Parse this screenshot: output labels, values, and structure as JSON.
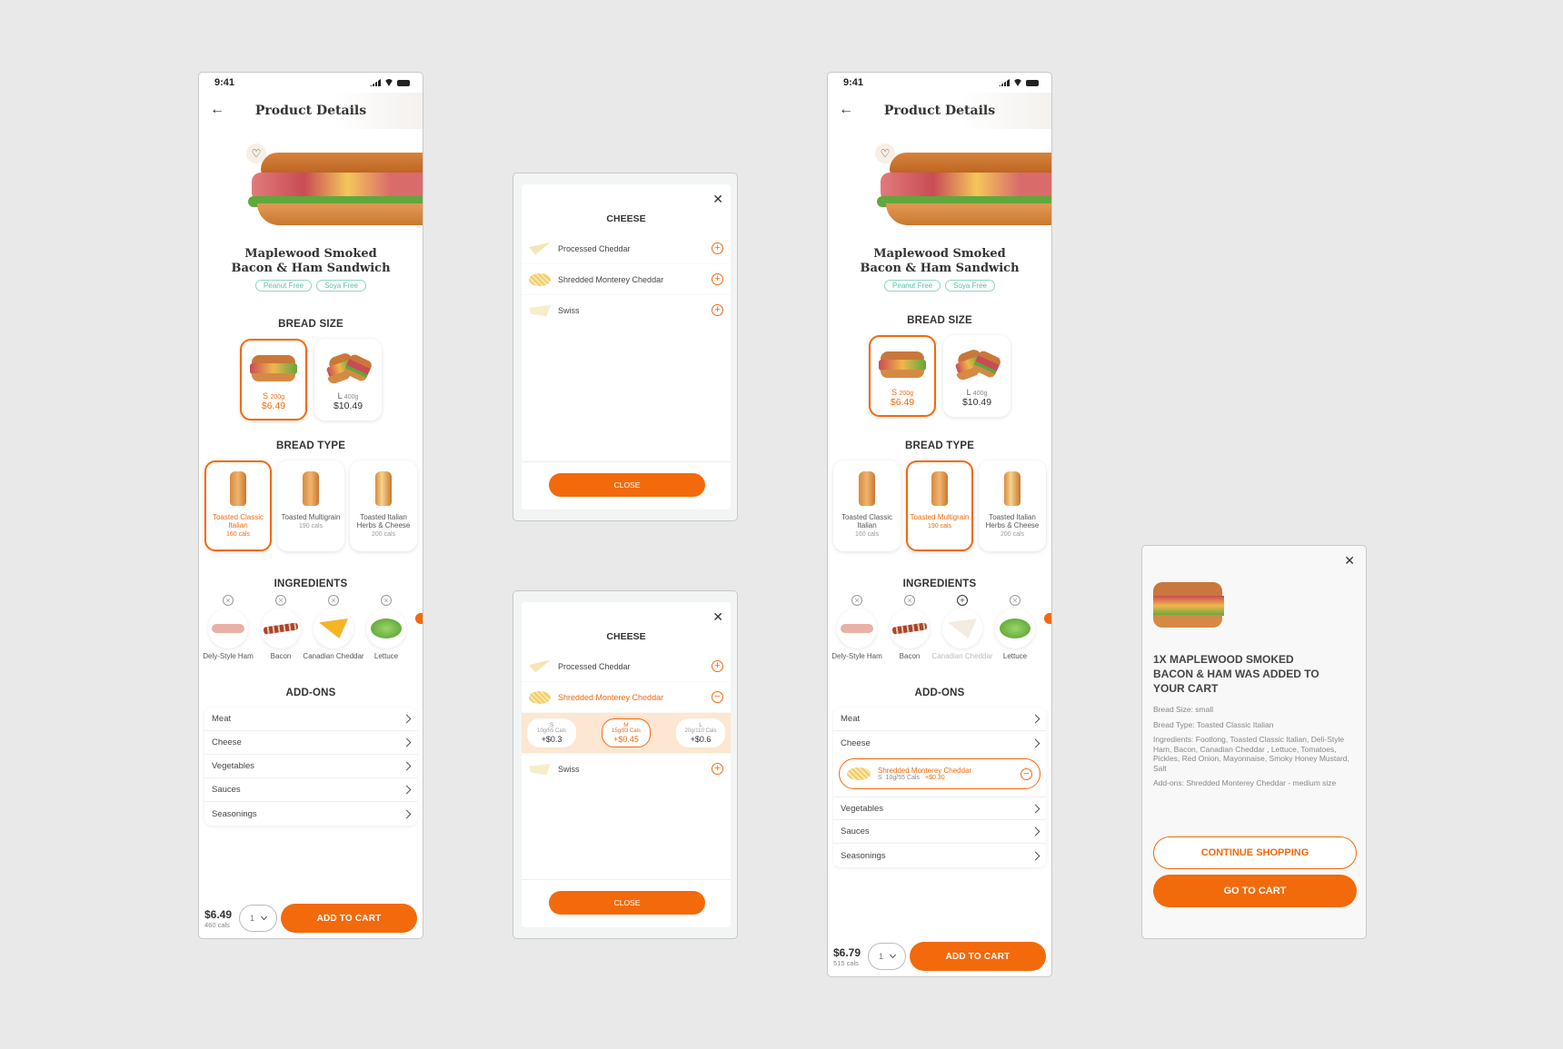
{
  "colors": {
    "accent": "#f26a0c",
    "background": "#e9e9e9",
    "tag": "#5bbfa6"
  },
  "screen1": {
    "time": "9:41",
    "title": "Product Details",
    "product_name_1": "Maplewood Smoked",
    "product_name_2": "Bacon & Ham Sandwich",
    "tags": [
      "Peanut Free",
      "Soya Free"
    ],
    "bread_size_label": "BREAD SIZE",
    "sizes": [
      {
        "size": "S",
        "weight": "200g",
        "price": "$6.49"
      },
      {
        "size": "L",
        "weight": "400g",
        "price": "$10.49"
      }
    ],
    "bread_type_label": "BREAD TYPE",
    "types": [
      {
        "name": "Toasted Classic Italian",
        "cals": "160 cals"
      },
      {
        "name": "Toasted Multigrain",
        "cals": "190 cals"
      },
      {
        "name": "Toasted Italian Herbs & Cheese",
        "cals": "200 cals"
      }
    ],
    "ingredients_label": "INGREDIENTS",
    "ingredients": [
      "Dely-Style Ham",
      "Bacon",
      "Canadian Cheddar",
      "Lettuce"
    ],
    "addons_label": "ADD-ONS",
    "addons": [
      "Meat",
      "Cheese",
      "Vegetables",
      "Sauces",
      "Seasonings"
    ],
    "price": "$6.49",
    "cals": "460 cals",
    "qty": "1",
    "add_to_cart": "ADD TO CART"
  },
  "modal1": {
    "title": "CHEESE",
    "items": [
      "Processed Cheddar",
      "Shredded Monterey Cheddar",
      "Swiss"
    ],
    "close": "CLOSE"
  },
  "modal2": {
    "title": "CHEESE",
    "items": [
      "Processed Cheddar",
      "Shredded Monterey Cheddar",
      "Swiss"
    ],
    "portions": [
      {
        "size": "S",
        "cals": "10g/55 Cals",
        "price": "+$0.3"
      },
      {
        "size": "M",
        "cals": "15g/83 Cals",
        "price": "+$0.45"
      },
      {
        "size": "L",
        "cals": "20g/110 Cals",
        "price": "+$0.6"
      }
    ],
    "close": "CLOSE"
  },
  "screen2": {
    "time": "9:41",
    "title": "Product Details",
    "product_name_1": "Maplewood Smoked",
    "product_name_2": "Bacon & Ham Sandwich",
    "tags": [
      "Peanut Free",
      "Soya Free"
    ],
    "bread_size_label": "BREAD SIZE",
    "sizes": [
      {
        "size": "S",
        "weight": "200g",
        "price": "$6.49"
      },
      {
        "size": "L",
        "weight": "400g",
        "price": "$10.49"
      }
    ],
    "bread_type_label": "BREAD TYPE",
    "types": [
      {
        "name": "Toasted Classic Italian",
        "cals": "160 cals"
      },
      {
        "name": "Toasted Multigrain",
        "cals": "190 cals"
      },
      {
        "name": "Toasted Italian Herbs & Cheese",
        "cals": "200 cals"
      }
    ],
    "ingredients_label": "INGREDIENTS",
    "ingredients": [
      "Dely-Style Ham",
      "Bacon",
      "Canadian Cheddar",
      "Lettuce"
    ],
    "addons_label": "ADD-ONS",
    "addons": [
      "Meat",
      "Cheese",
      "Vegetables",
      "Sauces",
      "Seasonings"
    ],
    "selected_addon": {
      "name": "Shredded Monterey Cheddar",
      "size": "S",
      "cals": "10g/55 Cals",
      "price": "+$0.30"
    },
    "price": "$6.79",
    "cals": "515 cals",
    "qty": "1",
    "add_to_cart": "ADD TO CART"
  },
  "cart_popup": {
    "title": "1X MAPLEWOOD SMOKED BACON & HAM  WAS ADDED TO YOUR CART",
    "bread_size": "Bread Size: small",
    "bread_type": "Bread Type: Toasted Classic Italian",
    "ingredients": "Ingredients: Footlong, Toasted Classic Italian, Deli-Style Ham, Bacon, Canadian Cheddar , Lettuce, Tomatoes, Pickles, Red Onion, Mayonnaise, Smoky Honey Mustard, Salt",
    "addons": "Add-ons: Shredded Monterey Cheddar - medium size",
    "continue": "CONTINUE SHOPPING",
    "go_to_cart": "GO TO CART"
  }
}
